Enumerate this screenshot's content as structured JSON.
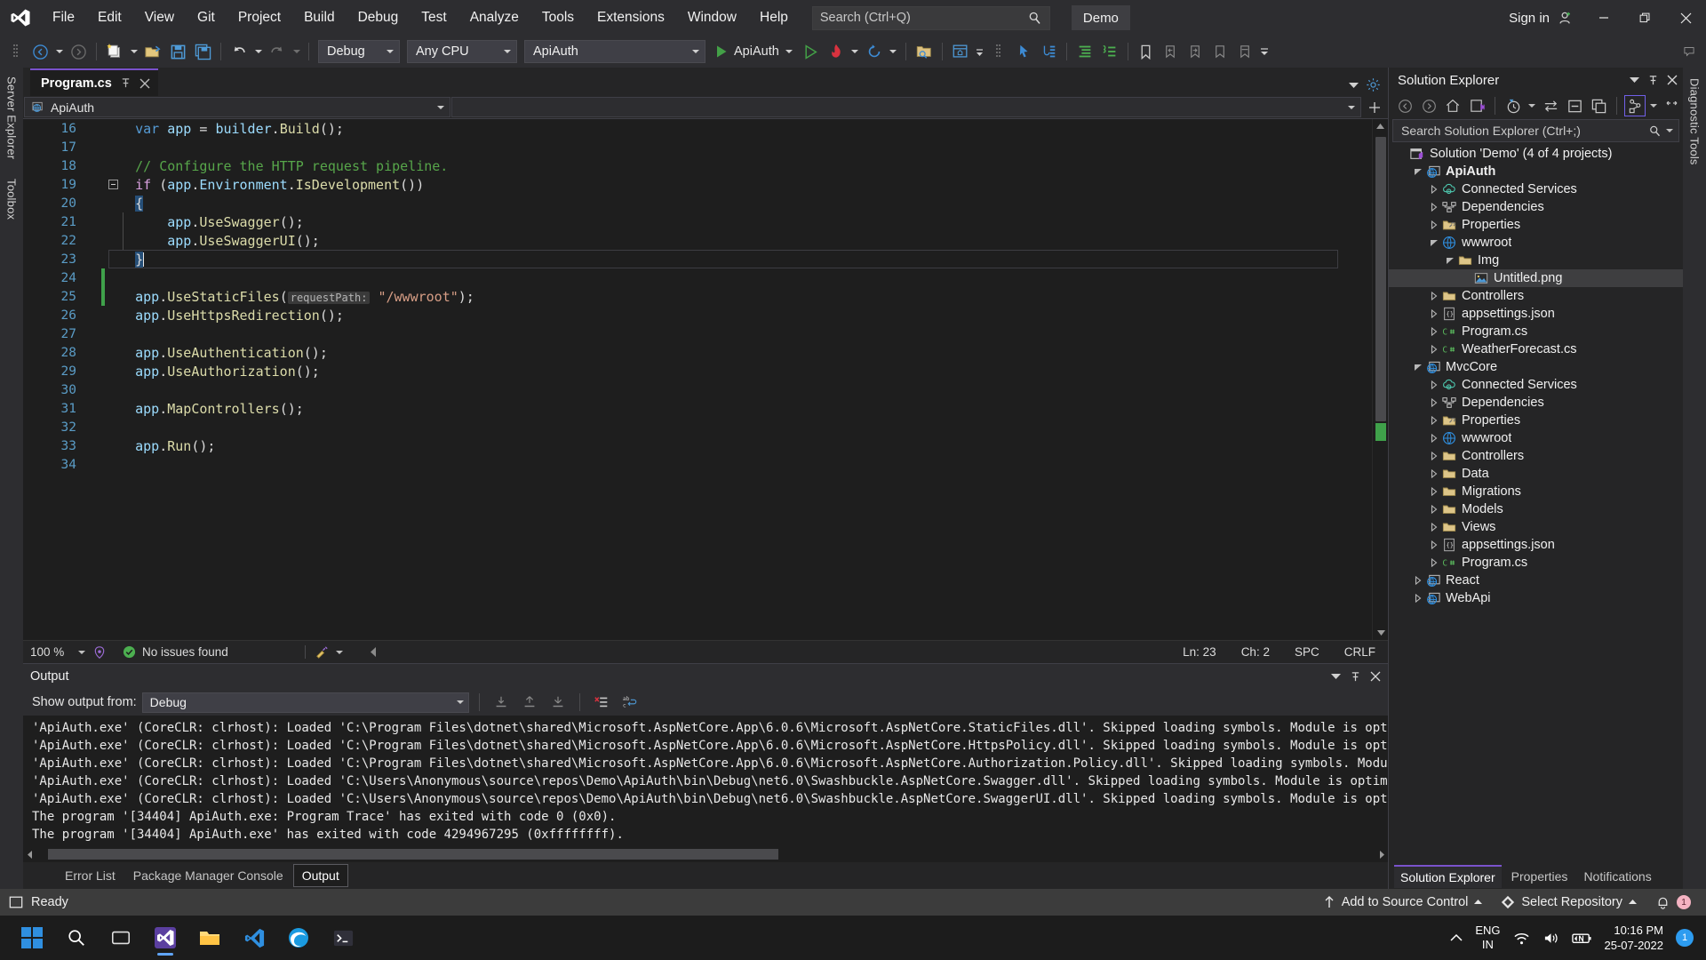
{
  "titlebar": {
    "menus": [
      "File",
      "Edit",
      "View",
      "Git",
      "Project",
      "Build",
      "Debug",
      "Test",
      "Analyze",
      "Tools",
      "Extensions",
      "Window",
      "Help"
    ],
    "search_placeholder": "Search (Ctrl+Q)",
    "solution_button": "Demo",
    "signin": "Sign in"
  },
  "toolbar": {
    "configuration": "Debug",
    "platform": "Any CPU",
    "startup_project": "ApiAuth",
    "run_label": "ApiAuth"
  },
  "left_rail": {
    "items": [
      "Server Explorer",
      "Toolbox"
    ]
  },
  "right_rail": {
    "items": [
      "Diagnostic Tools"
    ]
  },
  "editor": {
    "tab_name": "Program.cs",
    "nav_class": "ApiAuth",
    "nav_member": "",
    "lines": [
      {
        "n": "16",
        "tokens": [
          {
            "t": "    ",
            "c": "k-pun"
          },
          {
            "t": "var",
            "c": "k-kw"
          },
          {
            "t": " ",
            "c": "k-pun"
          },
          {
            "t": "app",
            "c": "k-var"
          },
          {
            "t": " = ",
            "c": "k-pun"
          },
          {
            "t": "builder",
            "c": "k-var"
          },
          {
            "t": ".",
            "c": "k-pun"
          },
          {
            "t": "Build",
            "c": "k-mth"
          },
          {
            "t": "();",
            "c": "k-pun"
          }
        ]
      },
      {
        "n": "17",
        "tokens": []
      },
      {
        "n": "18",
        "tokens": [
          {
            "t": "    // Configure the HTTP request pipeline.",
            "c": "k-com"
          }
        ]
      },
      {
        "n": "19",
        "fold": true,
        "tokens": [
          {
            "t": "    ",
            "c": "k-pun"
          },
          {
            "t": "if",
            "c": "k-ctl"
          },
          {
            "t": " (",
            "c": "k-pun"
          },
          {
            "t": "app",
            "c": "k-var"
          },
          {
            "t": ".",
            "c": "k-pun"
          },
          {
            "t": "Environment",
            "c": "k-var"
          },
          {
            "t": ".",
            "c": "k-pun"
          },
          {
            "t": "IsDevelopment",
            "c": "k-mth"
          },
          {
            "t": "())",
            "c": "k-pun"
          }
        ]
      },
      {
        "n": "20",
        "brace": true,
        "tokens": [
          {
            "t": "    ",
            "c": "k-pun"
          },
          {
            "t": "{",
            "c": "k-pun"
          }
        ]
      },
      {
        "n": "21",
        "guide": true,
        "tokens": [
          {
            "t": "        ",
            "c": "k-pun"
          },
          {
            "t": "app",
            "c": "k-var"
          },
          {
            "t": ".",
            "c": "k-pun"
          },
          {
            "t": "UseSwagger",
            "c": "k-mth"
          },
          {
            "t": "();",
            "c": "k-pun"
          }
        ]
      },
      {
        "n": "22",
        "guide": true,
        "tokens": [
          {
            "t": "        ",
            "c": "k-pun"
          },
          {
            "t": "app",
            "c": "k-var"
          },
          {
            "t": ".",
            "c": "k-pun"
          },
          {
            "t": "UseSwaggerUI",
            "c": "k-mth"
          },
          {
            "t": "();",
            "c": "k-pun"
          }
        ]
      },
      {
        "n": "23",
        "current": true,
        "brace": true,
        "caret": true,
        "tokens": [
          {
            "t": "    ",
            "c": "k-pun"
          },
          {
            "t": "}",
            "c": "k-pun"
          }
        ]
      },
      {
        "n": "24",
        "change": true,
        "tokens": []
      },
      {
        "n": "25",
        "change": true,
        "tokens": [
          {
            "t": "    ",
            "c": "k-pun"
          },
          {
            "t": "app",
            "c": "k-var"
          },
          {
            "t": ".",
            "c": "k-pun"
          },
          {
            "t": "UseStaticFiles",
            "c": "k-mth"
          },
          {
            "t": "(",
            "c": "k-pun"
          },
          {
            "t": "requestPath:",
            "c": "hint"
          },
          {
            "t": " ",
            "c": "k-pun"
          },
          {
            "t": "\"/wwwroot\"",
            "c": "k-str"
          },
          {
            "t": ");",
            "c": "k-pun"
          }
        ]
      },
      {
        "n": "26",
        "tokens": [
          {
            "t": "    ",
            "c": "k-pun"
          },
          {
            "t": "app",
            "c": "k-var"
          },
          {
            "t": ".",
            "c": "k-pun"
          },
          {
            "t": "UseHttpsRedirection",
            "c": "k-mth"
          },
          {
            "t": "();",
            "c": "k-pun"
          }
        ]
      },
      {
        "n": "27",
        "tokens": []
      },
      {
        "n": "28",
        "tokens": [
          {
            "t": "    ",
            "c": "k-pun"
          },
          {
            "t": "app",
            "c": "k-var"
          },
          {
            "t": ".",
            "c": "k-pun"
          },
          {
            "t": "UseAuthentication",
            "c": "k-mth"
          },
          {
            "t": "();",
            "c": "k-pun"
          }
        ]
      },
      {
        "n": "29",
        "tokens": [
          {
            "t": "    ",
            "c": "k-pun"
          },
          {
            "t": "app",
            "c": "k-var"
          },
          {
            "t": ".",
            "c": "k-pun"
          },
          {
            "t": "UseAuthorization",
            "c": "k-mth"
          },
          {
            "t": "();",
            "c": "k-pun"
          }
        ]
      },
      {
        "n": "30",
        "tokens": []
      },
      {
        "n": "31",
        "tokens": [
          {
            "t": "    ",
            "c": "k-pun"
          },
          {
            "t": "app",
            "c": "k-var"
          },
          {
            "t": ".",
            "c": "k-pun"
          },
          {
            "t": "MapControllers",
            "c": "k-mth"
          },
          {
            "t": "();",
            "c": "k-pun"
          }
        ]
      },
      {
        "n": "32",
        "tokens": []
      },
      {
        "n": "33",
        "tokens": [
          {
            "t": "    ",
            "c": "k-pun"
          },
          {
            "t": "app",
            "c": "k-var"
          },
          {
            "t": ".",
            "c": "k-pun"
          },
          {
            "t": "Run",
            "c": "k-mth"
          },
          {
            "t": "();",
            "c": "k-pun"
          }
        ]
      },
      {
        "n": "34",
        "tokens": []
      }
    ],
    "status": {
      "zoom": "100 %",
      "issues": "No issues found",
      "line": "Ln: 23",
      "col": "Ch: 2",
      "spaces": "SPC",
      "eol": "CRLF"
    }
  },
  "output": {
    "title": "Output",
    "show_output_from_label": "Show output from:",
    "source": "Debug",
    "lines": [
      "'ApiAuth.exe' (CoreCLR: clrhost): Loaded 'C:\\Program Files\\dotnet\\shared\\Microsoft.AspNetCore.App\\6.0.6\\Microsoft.AspNetCore.StaticFiles.dll'. Skipped loading symbols. Module is optimi",
      "'ApiAuth.exe' (CoreCLR: clrhost): Loaded 'C:\\Program Files\\dotnet\\shared\\Microsoft.AspNetCore.App\\6.0.6\\Microsoft.AspNetCore.HttpsPolicy.dll'. Skipped loading symbols. Module is optimi",
      "'ApiAuth.exe' (CoreCLR: clrhost): Loaded 'C:\\Program Files\\dotnet\\shared\\Microsoft.AspNetCore.App\\6.0.6\\Microsoft.AspNetCore.Authorization.Policy.dll'. Skipped loading symbols. Module",
      "'ApiAuth.exe' (CoreCLR: clrhost): Loaded 'C:\\Users\\Anonymous\\source\\repos\\Demo\\ApiAuth\\bin\\Debug\\net6.0\\Swashbuckle.AspNetCore.Swagger.dll'. Skipped loading symbols. Module is optimize",
      "'ApiAuth.exe' (CoreCLR: clrhost): Loaded 'C:\\Users\\Anonymous\\source\\repos\\Demo\\ApiAuth\\bin\\Debug\\net6.0\\Swashbuckle.AspNetCore.SwaggerUI.dll'. Skipped loading symbols. Module is optimi",
      "The program '[34404] ApiAuth.exe: Program Trace' has exited with code 0 (0x0).",
      "The program '[34404] ApiAuth.exe' has exited with code 4294967295 (0xffffffff)."
    ],
    "tabs": [
      {
        "label": "Error List",
        "active": false
      },
      {
        "label": "Package Manager Console",
        "active": false
      },
      {
        "label": "Output",
        "active": true
      }
    ]
  },
  "solution_explorer": {
    "title": "Solution Explorer",
    "search_placeholder": "Search Solution Explorer (Ctrl+;)",
    "tree": [
      {
        "label": "Solution 'Demo' (4 of 4 projects)",
        "depth": 0,
        "icon": "solution",
        "expander": "none",
        "bold": false,
        "selected": false
      },
      {
        "label": "ApiAuth",
        "depth": 1,
        "icon": "project-web",
        "expander": "open",
        "bold": true,
        "selected": false
      },
      {
        "label": "Connected Services",
        "depth": 2,
        "icon": "connected-services",
        "expander": "closed",
        "bold": false,
        "selected": false
      },
      {
        "label": "Dependencies",
        "depth": 2,
        "icon": "dependencies",
        "expander": "closed",
        "bold": false,
        "selected": false
      },
      {
        "label": "Properties",
        "depth": 2,
        "icon": "properties",
        "expander": "closed",
        "bold": false,
        "selected": false
      },
      {
        "label": "wwwroot",
        "depth": 2,
        "icon": "wwwroot",
        "expander": "open",
        "bold": false,
        "selected": false
      },
      {
        "label": "Img",
        "depth": 3,
        "icon": "folder",
        "expander": "open",
        "bold": false,
        "selected": false
      },
      {
        "label": "Untitled.png",
        "depth": 4,
        "icon": "image",
        "expander": "none",
        "bold": false,
        "selected": true
      },
      {
        "label": "Controllers",
        "depth": 2,
        "icon": "folder",
        "expander": "closed",
        "bold": false,
        "selected": false
      },
      {
        "label": "appsettings.json",
        "depth": 2,
        "icon": "json",
        "expander": "closed",
        "bold": false,
        "selected": false
      },
      {
        "label": "Program.cs",
        "depth": 2,
        "icon": "csharp",
        "expander": "closed",
        "bold": false,
        "selected": false
      },
      {
        "label": "WeatherForecast.cs",
        "depth": 2,
        "icon": "csharp",
        "expander": "closed",
        "bold": false,
        "selected": false
      },
      {
        "label": "MvcCore",
        "depth": 1,
        "icon": "project-web",
        "expander": "open",
        "bold": false,
        "selected": false
      },
      {
        "label": "Connected Services",
        "depth": 2,
        "icon": "connected-services",
        "expander": "closed",
        "bold": false,
        "selected": false
      },
      {
        "label": "Dependencies",
        "depth": 2,
        "icon": "dependencies",
        "expander": "closed",
        "bold": false,
        "selected": false
      },
      {
        "label": "Properties",
        "depth": 2,
        "icon": "properties",
        "expander": "closed",
        "bold": false,
        "selected": false
      },
      {
        "label": "wwwroot",
        "depth": 2,
        "icon": "wwwroot",
        "expander": "closed",
        "bold": false,
        "selected": false
      },
      {
        "label": "Controllers",
        "depth": 2,
        "icon": "folder",
        "expander": "closed",
        "bold": false,
        "selected": false
      },
      {
        "label": "Data",
        "depth": 2,
        "icon": "folder",
        "expander": "closed",
        "bold": false,
        "selected": false
      },
      {
        "label": "Migrations",
        "depth": 2,
        "icon": "folder",
        "expander": "closed",
        "bold": false,
        "selected": false
      },
      {
        "label": "Models",
        "depth": 2,
        "icon": "folder",
        "expander": "closed",
        "bold": false,
        "selected": false
      },
      {
        "label": "Views",
        "depth": 2,
        "icon": "folder",
        "expander": "closed",
        "bold": false,
        "selected": false
      },
      {
        "label": "appsettings.json",
        "depth": 2,
        "icon": "json",
        "expander": "closed",
        "bold": false,
        "selected": false
      },
      {
        "label": "Program.cs",
        "depth": 2,
        "icon": "csharp",
        "expander": "closed",
        "bold": false,
        "selected": false
      },
      {
        "label": "React",
        "depth": 1,
        "icon": "project-web",
        "expander": "closed",
        "bold": false,
        "selected": false
      },
      {
        "label": "WebApi",
        "depth": 1,
        "icon": "project-web",
        "expander": "closed",
        "bold": false,
        "selected": false
      }
    ],
    "footer_tabs": [
      {
        "label": "Solution Explorer",
        "active": true
      },
      {
        "label": "Properties",
        "active": false
      },
      {
        "label": "Notifications",
        "active": false
      }
    ]
  },
  "vs_status": {
    "ready": "Ready",
    "source_control": "Add to Source Control",
    "repository": "Select Repository",
    "notification_count": "1"
  },
  "taskbar": {
    "language_primary": "ENG",
    "language_secondary": "IN",
    "time": "10:16 PM",
    "date": "25-07-2022",
    "tray_badge": "1"
  },
  "colors": {
    "accent_purple": "#7a52cc",
    "run_green": "#3fa14a",
    "titlebar": "#2d2d30",
    "editor_bg": "#1e1e1e",
    "status_bg": "#3c3c3c"
  }
}
